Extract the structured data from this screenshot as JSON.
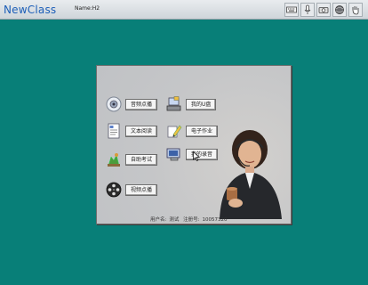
{
  "topbar": {
    "brand": "NewClass",
    "user": "Name:H2"
  },
  "tray": {
    "icons": [
      "keyboard-icon",
      "microphone-icon",
      "camera-icon",
      "globe-icon",
      "hand-icon"
    ]
  },
  "apps": [
    {
      "id": "audio-on-demand",
      "label": "音频点播",
      "icon": "speaker-icon"
    },
    {
      "id": "my-udisk",
      "label": "我的U盘",
      "icon": "computer-disk-icon"
    },
    {
      "id": "text-reading",
      "label": "文本阅读",
      "icon": "document-icon"
    },
    {
      "id": "homework",
      "label": "电子作业",
      "icon": "pencil-icon"
    },
    {
      "id": "self-test",
      "label": "自助考试",
      "icon": "test-figure-icon"
    },
    {
      "id": "my-records",
      "label": "我的录音",
      "icon": "recorder-icon"
    },
    {
      "id": "video-on-demand",
      "label": "视频点播",
      "icon": "film-reel-icon"
    }
  ],
  "status": {
    "username_label": "用户名:",
    "username": "测试",
    "regno_label": "注册号:",
    "regno": "10057320"
  },
  "colors": {
    "desktop": "#087f78",
    "window": "#c4c5c7",
    "brand": "#1d5fb8"
  }
}
